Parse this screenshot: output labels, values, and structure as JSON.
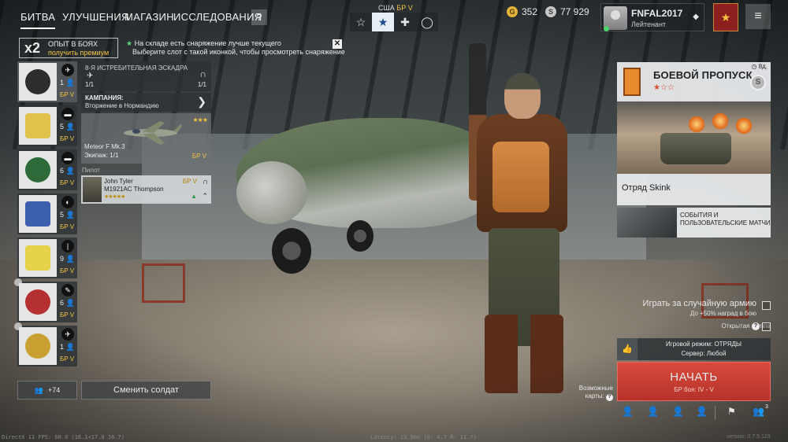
{
  "nav": {
    "tabs": [
      {
        "label": "БИТВА"
      },
      {
        "label": "УЛУЧШЕНИЯ"
      },
      {
        "label": "МАГАЗИН"
      },
      {
        "label": "ИССЛЕДОВАНИЯ"
      }
    ],
    "help": "?"
  },
  "modes": {
    "nation": "США",
    "br": "БР V",
    "buttons": [
      {
        "icon": "star-outline-icon",
        "glyph": "☆"
      },
      {
        "icon": "star-badge-icon",
        "glyph": "★"
      },
      {
        "icon": "cross-icon",
        "glyph": "✚"
      },
      {
        "icon": "circle-icon",
        "glyph": "◯"
      }
    ]
  },
  "currency": {
    "gold": "352",
    "silver": "77 929",
    "gold_glyph": "G",
    "silver_glyph": "S"
  },
  "profile": {
    "name": "FNFAL2017",
    "rank": "Лейтенант",
    "arrow": "◆",
    "rank_badge": "★",
    "menu": "≡"
  },
  "xp": {
    "mult": "x2",
    "title": "ОПЫТ В БОЯХ",
    "sub": "получить премиум"
  },
  "notice": {
    "line1": "На складе есть снаряжение лучше текущего",
    "line2": "Выберите слот с такой иконкой, чтобы просмотреть снаряжение",
    "star": "★",
    "close": "✕"
  },
  "squads": [
    {
      "count": "1",
      "br": "БР V",
      "emblem": "#2d2d2d",
      "cls": "✈"
    },
    {
      "count": "5",
      "br": "БР V",
      "emblem": "#e0c14a",
      "cls": "▬"
    },
    {
      "count": "6",
      "br": "БР V",
      "emblem": "#2f6a3a",
      "cls": "▬"
    },
    {
      "count": "5",
      "br": "БР V",
      "emblem": "#3d5fb0",
      "cls": "◐"
    },
    {
      "count": "9",
      "br": "БР V",
      "emblem": "#e6d24a",
      "cls": "|"
    },
    {
      "count": "6",
      "br": "БР V",
      "emblem": "#b53030",
      "cls": "✎"
    },
    {
      "count": "1",
      "br": "БР V",
      "emblem": "#caa030",
      "cls": "✈"
    }
  ],
  "detail": {
    "title": "8-Я ИСТРЕБИТЕЛЬНАЯ ЭСКАДРА",
    "plane_count": "1/1",
    "crew_count": "1/1",
    "campaign_label": "КАМПАНИЯ:",
    "campaign_value": "Вторжение в Нормандию",
    "campaign_arrow": "❯",
    "vehicle_name": "Meteor F Mk.3",
    "vehicle_crew": "Экипаж: 1/1",
    "vehicle_stars": "★★★",
    "vehicle_br": "БР V",
    "pilot_label": "Пилот",
    "soldier": {
      "name": "John Tyler",
      "weapon": "M1921AC Thompson",
      "stars": "★★★★★",
      "br": "БР V",
      "helm": "∩",
      "rankup": "⌃",
      "up": "▲"
    }
  },
  "bottom_left": {
    "friends": "+74",
    "change_soldier": "Сменить солдат"
  },
  "debug": {
    "fps": "DirectX 11  FPS: 60.0 (16.1<17.0 16.7)",
    "latency": "Latency: 13.8ms (A: 4.7 R: 11.7)",
    "version": "version: 0.7.5.129"
  },
  "battle_pass": {
    "title": "БОЕВОЙ ПРОПУСК",
    "stars": "★☆☆",
    "timer": "8д.",
    "coin": "S"
  },
  "event": {
    "title": "Отряд Skink",
    "events_label": "СОБЫТИЯ И ПОЛЬЗОВАТЕЛЬСКИЕ МАТЧИ"
  },
  "random_army": {
    "label": "Играть за случайную армию",
    "sub": "До +50% наград в бою",
    "open_group": "Открытая группа",
    "help": "?"
  },
  "game_mode": {
    "line1": "Игровой режим: ОТРЯДЫ",
    "line2": "Сервер: Любой",
    "like": "👍"
  },
  "start": {
    "label": "НАЧАТЬ",
    "br": "БР боя: IV - V"
  },
  "maps": {
    "label1": "Возможные",
    "label2": "карты:",
    "help": "?"
  },
  "bottom_icons": {
    "invite_count": "3"
  }
}
